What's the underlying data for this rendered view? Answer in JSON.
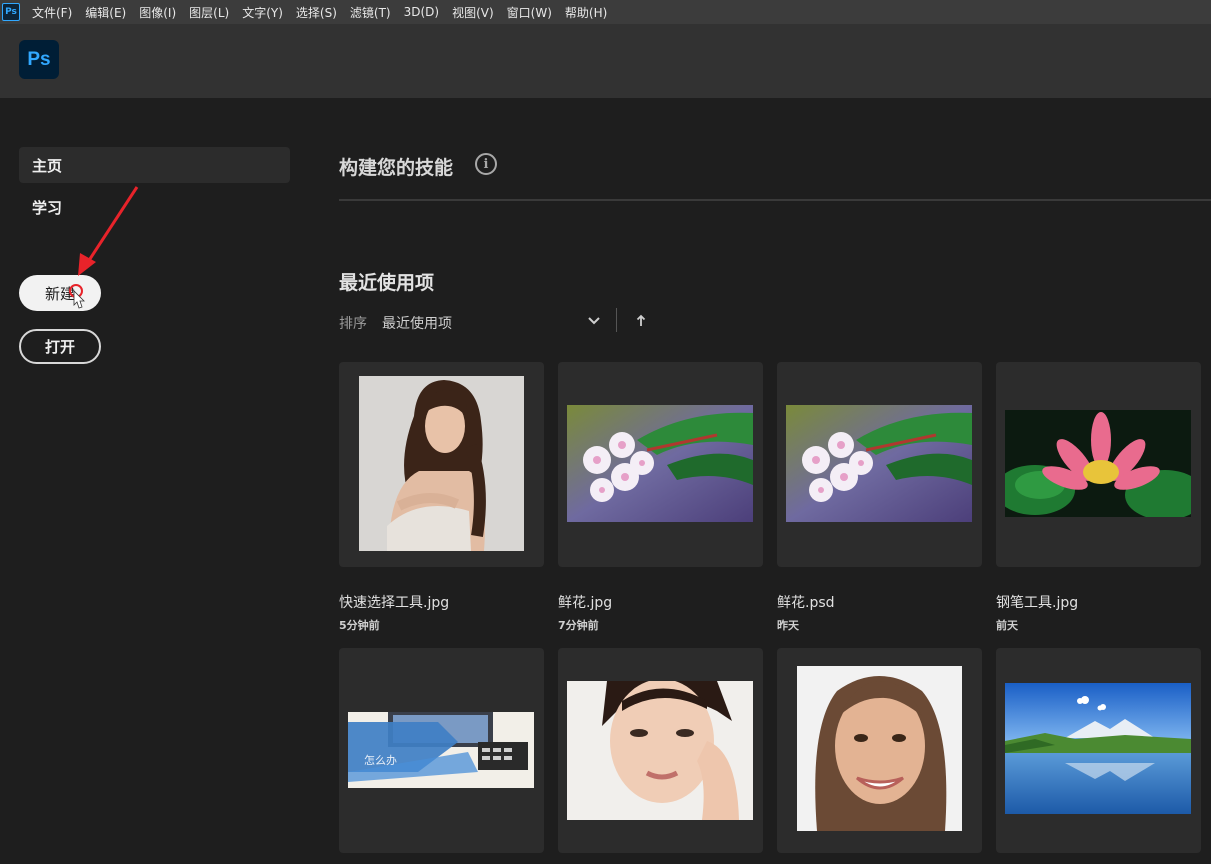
{
  "menubar": {
    "app_icon": "Ps",
    "items": [
      "文件(F)",
      "编辑(E)",
      "图像(I)",
      "图层(L)",
      "文字(Y)",
      "选择(S)",
      "滤镜(T)",
      "3D(D)",
      "视图(V)",
      "窗口(W)",
      "帮助(H)"
    ]
  },
  "header": {
    "logo": "Ps"
  },
  "sidebar": {
    "nav": [
      {
        "label": "主页"
      },
      {
        "label": "学习"
      }
    ],
    "new_button": "新建",
    "open_button": "打开"
  },
  "main": {
    "skills_title": "构建您的技能",
    "info_icon": "i",
    "recent_title": "最近使用项",
    "sort_label": "排序",
    "sort_value": "最近使用项",
    "files": [
      {
        "name": "快速选择工具.jpg",
        "time": "5分钟前",
        "thumb": "portrait-woman-curly-hair"
      },
      {
        "name": "鲜花.jpg",
        "time": "7分钟前",
        "thumb": "white-flowers-green-leaves"
      },
      {
        "name": "鲜花.psd",
        "time": "昨天",
        "thumb": "white-flowers-green-leaves"
      },
      {
        "name": "钢笔工具.jpg",
        "time": "前天",
        "thumb": "pink-lotus"
      },
      {
        "thumb": "laptop-blue-banner",
        "caption": "怎么办"
      },
      {
        "thumb": "woman-face-skincare"
      },
      {
        "thumb": "smiling-woman-portrait"
      },
      {
        "thumb": "mountain-lake-landscape"
      }
    ]
  },
  "colors": {
    "menubar_bg": "#3c3c3c",
    "header_bg": "#323232",
    "app_bg": "#1e1e1e",
    "card_bg": "#2c2c2c",
    "ps_blue": "#31a8ff",
    "annotation_red": "#e8232a"
  }
}
